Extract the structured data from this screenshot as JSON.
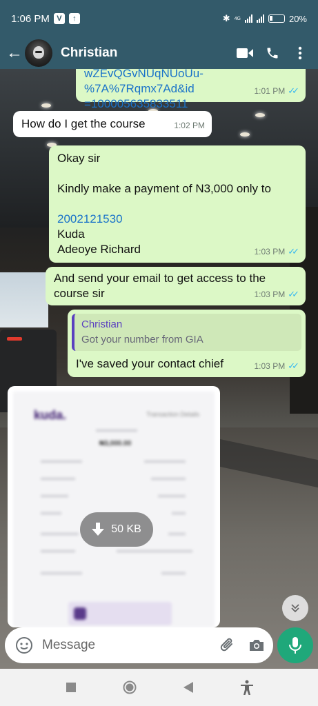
{
  "status_bar": {
    "time": "1:06 PM",
    "battery": "20%",
    "network": "4G"
  },
  "header": {
    "contact_name": "Christian"
  },
  "messages": [
    {
      "id": "m0",
      "direction": "out",
      "text_line1": "wZEvQGvNUqNUoUu-%7A%7Rqmx7Ad&id",
      "text_line2": "=100005635833511",
      "time": "1:01 PM",
      "status": "read"
    },
    {
      "id": "m1",
      "direction": "in",
      "text": "How do I get the course",
      "time": "1:02 PM"
    },
    {
      "id": "m2",
      "direction": "out",
      "line1": "Okay sir",
      "line2": "Kindly make a payment of N3,000 only to",
      "account_number": "2002121530",
      "bank": "Kuda",
      "account_name": "Adeoye Richard",
      "time": "1:03 PM",
      "status": "read"
    },
    {
      "id": "m3",
      "direction": "out",
      "line1": "And send your email to get access to the",
      "line2": "course sir",
      "time": "1:03 PM",
      "status": "read"
    },
    {
      "id": "m4",
      "direction": "out",
      "quote_name": "Christian",
      "quote_text": "Got your number from GIA",
      "text": "I've saved your contact chief",
      "time": "1:03 PM",
      "status": "read"
    }
  ],
  "attachment": {
    "logo": "kuda.",
    "header_text": "Transaction Details",
    "amount": "₦3,000.00",
    "size": "50 KB"
  },
  "composer": {
    "placeholder": "Message"
  },
  "colors": {
    "header": "#335a6a",
    "outgoing_bubble": "#dcf8c6",
    "incoming_bubble": "#ffffff",
    "mic_button": "#1fa87a",
    "read_ticks": "#34b7f1"
  }
}
